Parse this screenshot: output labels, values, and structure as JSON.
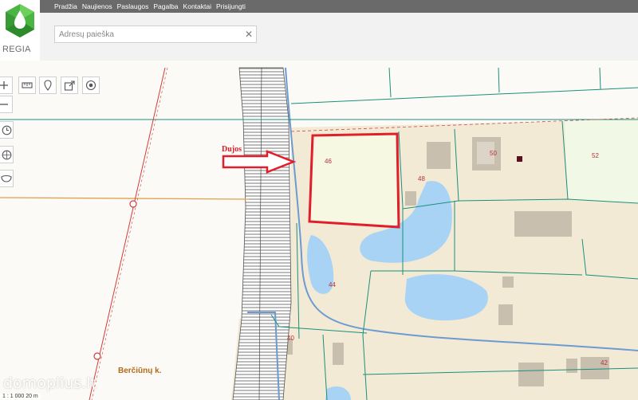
{
  "app": {
    "logo_text": "REGIA"
  },
  "nav": {
    "items": [
      "Pradžia",
      "Naujienos",
      "Paslaugos",
      "Pagalba",
      "Kontaktai",
      "Prisijungti"
    ]
  },
  "search": {
    "placeholder": "Adresų paieška",
    "value": "",
    "clear_icon": "close-icon"
  },
  "toolbar": {
    "icons": [
      "zoom-in-icon",
      "zoom-out-icon",
      "measure-ruler-icon",
      "location-pin-icon",
      "share-export-icon",
      "target-icon",
      "history-clock-icon",
      "compass-icon",
      "layers-icon"
    ]
  },
  "map": {
    "annotation": {
      "text": "Dujos",
      "color": "#e01f2b"
    },
    "parcel_labels": [
      "46",
      "48",
      "50",
      "52",
      "44",
      "40",
      "42"
    ],
    "place_label": "Berčiūnų k.",
    "scale_text": "1 : 1 000   20 m",
    "watermark": "domoplius.lt",
    "colors": {
      "parcel_line": "#1b8f7a",
      "water": "#a9d3f5",
      "built": "#c8bfae",
      "utility": "#e0a14a",
      "road": "#6b9bd1",
      "highlight": "#e01f2b"
    }
  }
}
